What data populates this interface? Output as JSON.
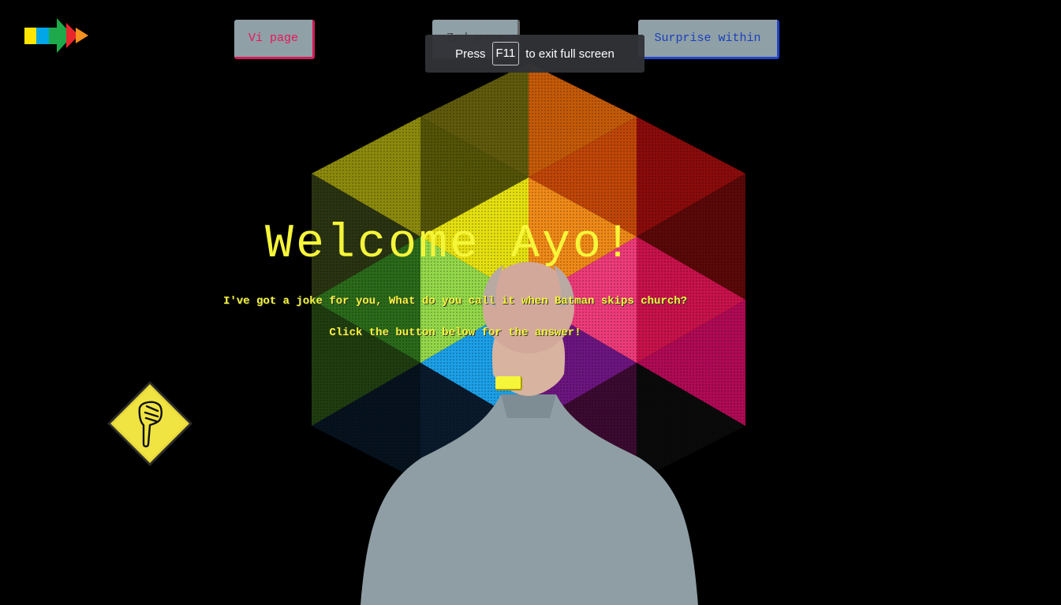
{
  "nav": {
    "vi_label": "Vi page",
    "zed_label": "Zed page",
    "surprise_label": "Surprise within"
  },
  "fullscreen_toast": {
    "prefix": "Press",
    "key": "F11",
    "suffix": "to exit full screen"
  },
  "main": {
    "heading": "Welcome Ayo!",
    "joke": "I've got a joke for you, What do you call it when Batman skips church?",
    "hint": "Click the button below for the answer!",
    "answer_button_label": ""
  },
  "icons": {
    "logo": "color-arrow-logo-icon",
    "sign": "pointing-hand-down-sign-icon"
  },
  "colors": {
    "background": "#000000",
    "text_accent": "#f5f53a",
    "vi_accent": "#e8155b",
    "surprise_accent": "#1a3fbf"
  }
}
